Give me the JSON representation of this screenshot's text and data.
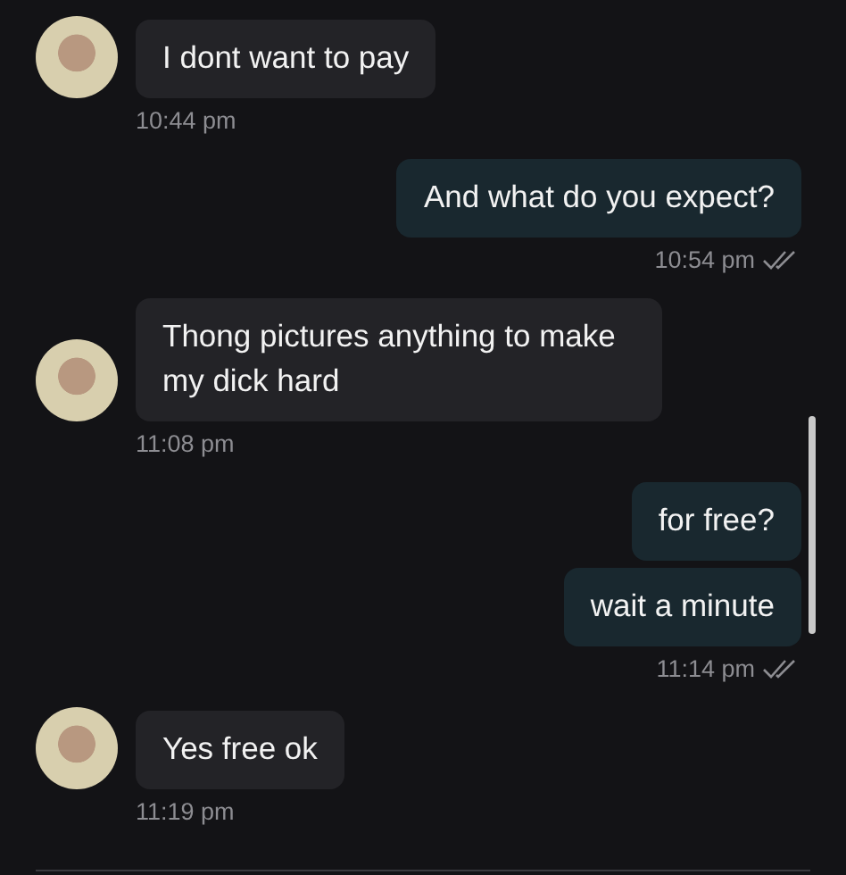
{
  "messages": [
    {
      "kind": "incoming",
      "bubbles": [
        "I dont want to pay"
      ],
      "time": "10:44 pm",
      "read": false
    },
    {
      "kind": "outgoing",
      "bubbles": [
        "And what do you expect?"
      ],
      "time": "10:54 pm",
      "read": true
    },
    {
      "kind": "incoming",
      "bubbles": [
        "Thong pictures anything to make my dick hard"
      ],
      "time": "11:08 pm",
      "read": false
    },
    {
      "kind": "outgoing",
      "bubbles": [
        "for free?",
        "wait a minute"
      ],
      "time": "11:14 pm",
      "read": true
    },
    {
      "kind": "incoming",
      "bubbles": [
        "Yes free ok"
      ],
      "time": "11:19 pm",
      "read": false
    }
  ]
}
